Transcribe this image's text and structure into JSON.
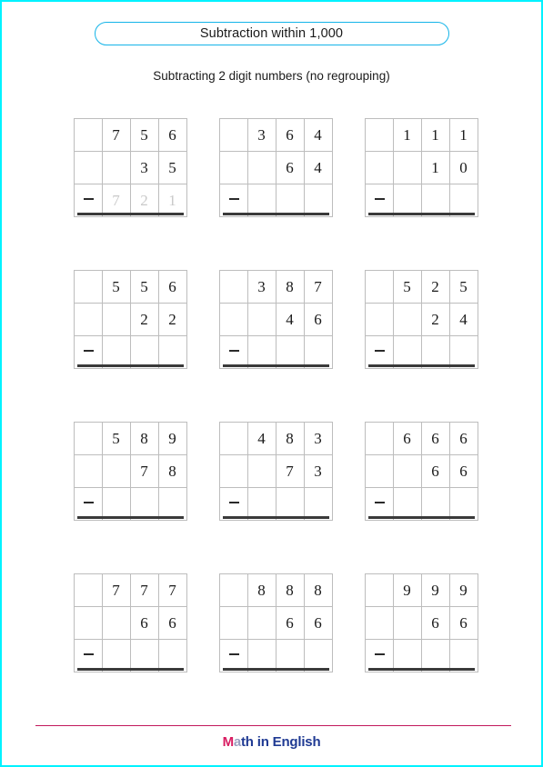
{
  "page": {
    "border_color": "#00f2ff",
    "background": "#ffffff"
  },
  "header": {
    "title": "Subtraction within 1,000",
    "title_border_color": "#14b4e8",
    "subtitle": "Subtracting 2 digit numbers (no regrouping)"
  },
  "worksheet": {
    "operator": "minus",
    "columns_per_problem": 4,
    "rows_per_problem": 3,
    "answer_color": "#c9c9c9",
    "grid_line_color": "#bdbdbd",
    "rule_color": "#3a3a3a",
    "rows": [
      {
        "problems": [
          {
            "minuend": [
              "",
              "7",
              "5",
              "6"
            ],
            "subtrahend": [
              "",
              "",
              "3",
              "5"
            ],
            "answer": [
              "",
              "7",
              "2",
              "1"
            ],
            "answer_visible": true
          },
          {
            "minuend": [
              "",
              "3",
              "6",
              "4"
            ],
            "subtrahend": [
              "",
              "",
              "6",
              "4"
            ],
            "answer": [
              "",
              "",
              "",
              ""
            ],
            "answer_visible": false
          },
          {
            "minuend": [
              "",
              "1",
              "1",
              "1"
            ],
            "subtrahend": [
              "",
              "",
              "1",
              "0"
            ],
            "answer": [
              "",
              "",
              "",
              ""
            ],
            "answer_visible": false
          }
        ]
      },
      {
        "problems": [
          {
            "minuend": [
              "",
              "5",
              "5",
              "6"
            ],
            "subtrahend": [
              "",
              "",
              "2",
              "2"
            ],
            "answer": [
              "",
              "",
              "",
              ""
            ],
            "answer_visible": false
          },
          {
            "minuend": [
              "",
              "3",
              "8",
              "7"
            ],
            "subtrahend": [
              "",
              "",
              "4",
              "6"
            ],
            "answer": [
              "",
              "",
              "",
              ""
            ],
            "answer_visible": false
          },
          {
            "minuend": [
              "",
              "5",
              "2",
              "5"
            ],
            "subtrahend": [
              "",
              "",
              "2",
              "4"
            ],
            "answer": [
              "",
              "",
              "",
              ""
            ],
            "answer_visible": false
          }
        ]
      },
      {
        "problems": [
          {
            "minuend": [
              "",
              "5",
              "8",
              "9"
            ],
            "subtrahend": [
              "",
              "",
              "7",
              "8"
            ],
            "answer": [
              "",
              "",
              "",
              ""
            ],
            "answer_visible": false
          },
          {
            "minuend": [
              "",
              "4",
              "8",
              "3"
            ],
            "subtrahend": [
              "",
              "",
              "7",
              "3"
            ],
            "answer": [
              "",
              "",
              "",
              ""
            ],
            "answer_visible": false
          },
          {
            "minuend": [
              "",
              "6",
              "6",
              "6"
            ],
            "subtrahend": [
              "",
              "",
              "6",
              "6"
            ],
            "answer": [
              "",
              "",
              "",
              ""
            ],
            "answer_visible": false
          }
        ]
      },
      {
        "problems": [
          {
            "minuend": [
              "",
              "7",
              "7",
              "7"
            ],
            "subtrahend": [
              "",
              "",
              "6",
              "6"
            ],
            "answer": [
              "",
              "",
              "",
              ""
            ],
            "answer_visible": false
          },
          {
            "minuend": [
              "",
              "8",
              "8",
              "8"
            ],
            "subtrahend": [
              "",
              "",
              "6",
              "6"
            ],
            "answer": [
              "",
              "",
              "",
              ""
            ],
            "answer_visible": false
          },
          {
            "minuend": [
              "",
              "9",
              "9",
              "9"
            ],
            "subtrahend": [
              "",
              "",
              "6",
              "6"
            ],
            "answer": [
              "",
              "",
              "",
              ""
            ],
            "answer_visible": false
          }
        ]
      }
    ]
  },
  "footer": {
    "rule_color": "#c2185b",
    "logo_m": "M",
    "logo_a": "a",
    "logo_rest": "th in English",
    "logo_m_color": "#d81b60",
    "logo_rest_color": "#1f3a93"
  }
}
